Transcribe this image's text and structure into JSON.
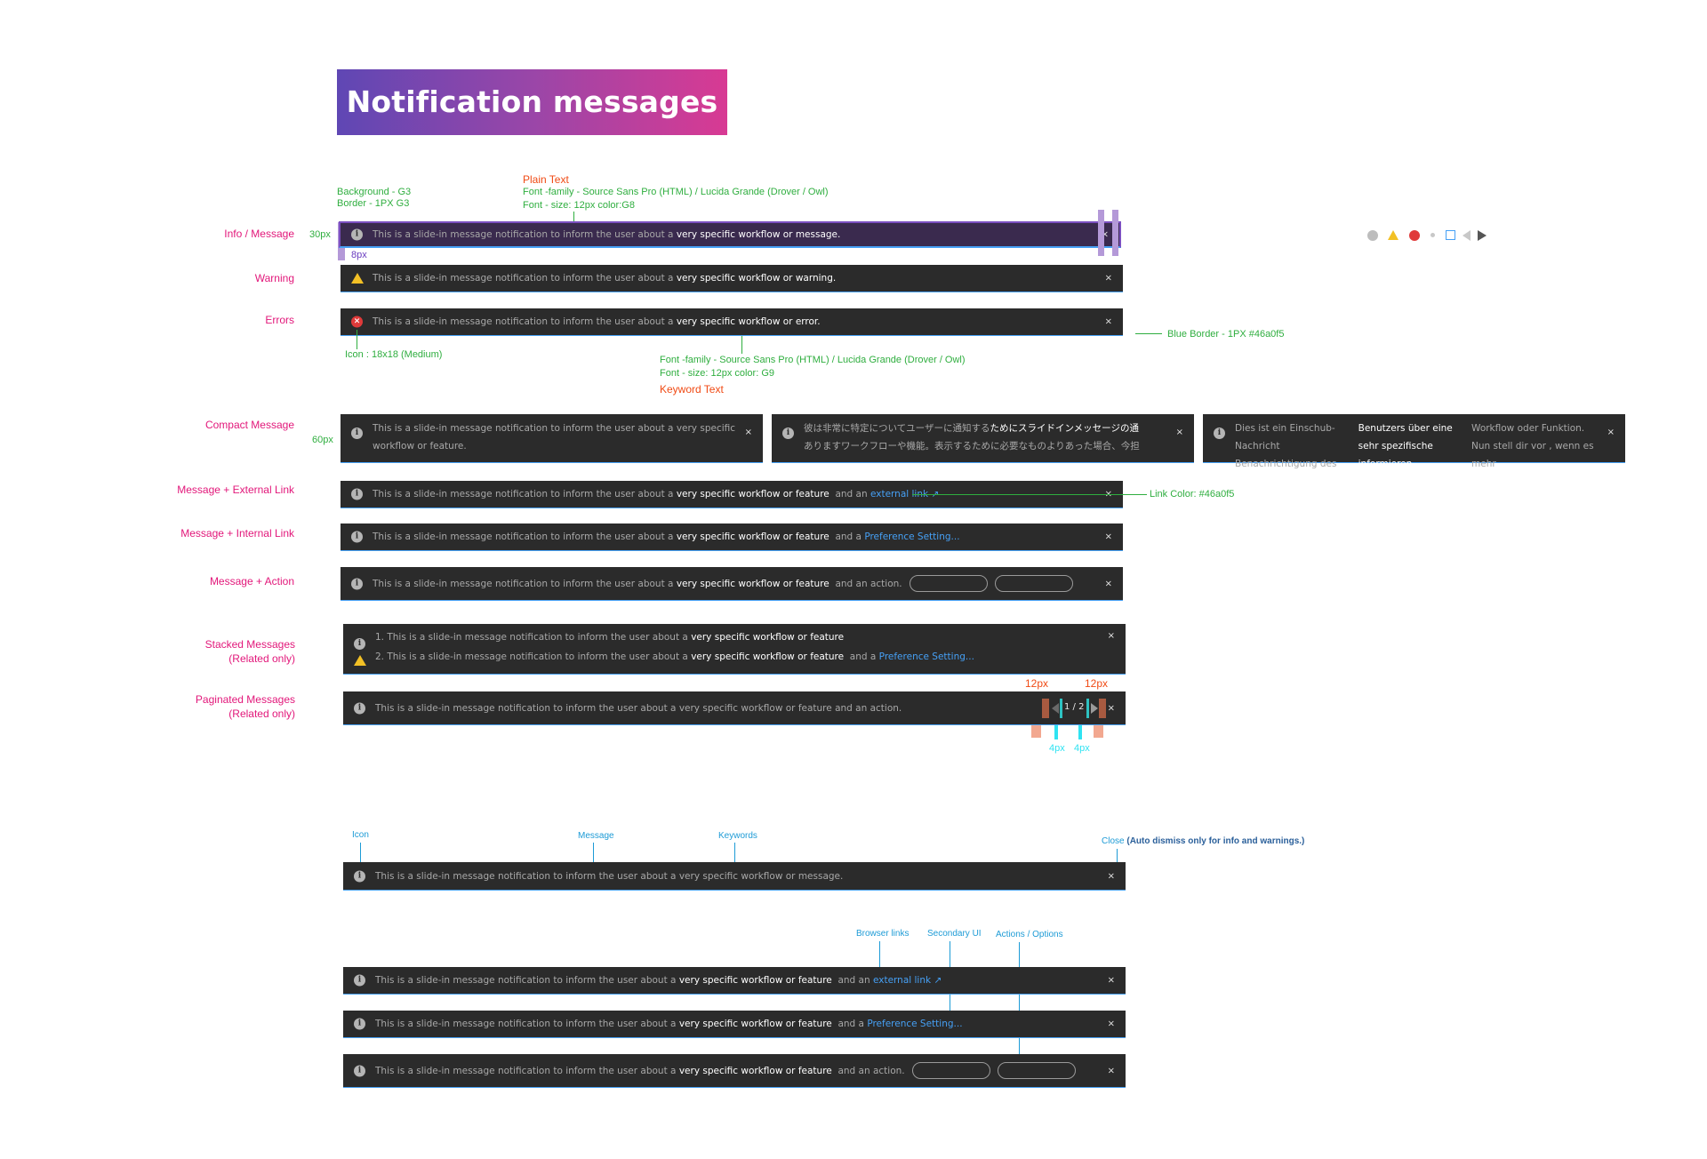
{
  "title": "Notification messages",
  "row_labels": {
    "info": "Info / Message",
    "warning": "Warning",
    "errors": "Errors",
    "compact": "Compact Message",
    "external": "Message + External Link",
    "internal": "Message + Internal Link",
    "action": "Message + Action",
    "stacked_1": "Stacked Messages",
    "stacked_2": "(Related only)",
    "paginated_1": "Paginated Messages",
    "paginated_2": "(Related only)"
  },
  "annotations": {
    "background_g3": "Background - G3",
    "border_g3": "Border - 1PX G3",
    "plain_text": "Plain Text",
    "font_family_1": "Font -family - Source Sans Pro (HTML) / Lucida Grande (Drover / Owl)",
    "font_size_1": "Font - size:  12px color:G8",
    "height_30": "30px",
    "pad_8": "8px",
    "blue_border": "Blue Border - 1PX #46a0f5",
    "icon_size": "Icon : 18x18 (Medium)",
    "font_family_2": "Font -family - Source Sans Pro (HTML) / Lucida Grande (Drover / Owl)",
    "font_size_2": "Font - size:  12px color: G9",
    "keyword_text": "Keyword Text",
    "height_60": "60px",
    "link_color": "Link Color: #46a0f5",
    "px12_a": "12px",
    "px12_b": "12px",
    "px4_a": "4px",
    "px4_b": "4px",
    "callout_icon": "Icon",
    "callout_message": "Message",
    "callout_keywords": "Keywords",
    "callout_close": "Close",
    "callout_close_note": "(Auto dismiss only for info and warnings.)",
    "callout_browser_links": "Browser links",
    "callout_secondary_ui": "Secondary UI",
    "callout_actions": "Actions / Options"
  },
  "messages": {
    "prefix": "This is a slide-in message notification to inform the user about a",
    "kw_message": "very specific workflow or message.",
    "kw_warning": "very specific workflow or warning.",
    "kw_error": "very specific workflow or error.",
    "kw_feature": "very specific workflow or feature",
    "compact_prefix": "This is a slide-in message notification to inform the user about a very specific workflow or feature.",
    "jp_plain": "彼は非常に特定についてユーザーに通知する",
    "jp_kw": "ためにスライドインメッセージの通",
    "jp_line2": "ありますワークフローや機能。表示するために必要なものよりあった場合、今担",
    "de_plain": "Dies ist ein Einschub-Nachricht Benachrichtigung des",
    "de_kw": "Benutzers über eine sehr spezifische informieren",
    "de_rest": "Workflow oder Funktion. Nun stell dir vor , wenn es mehr",
    "and_an": "and an",
    "and_a": "and a",
    "external_link": "external link",
    "pref_setting": "Preference Setting...",
    "and_an_action": "and an action.",
    "stacked_1_prefix": "1. This is a slide-in message notification to inform the user about a",
    "stacked_2_prefix": "2. This is a slide-in message notification to inform the user about a",
    "paginated_text": "This is a slide-in message notification to inform the user about a very specific workflow or feature  and an action.",
    "page_counter": "1 / 2",
    "close": "×"
  },
  "colors": {
    "background_g3": "#2b2b2b",
    "border_blue": "#46a0f5",
    "link": "#46a0f5",
    "label_pink": "#e2177a",
    "anno_green": "#2fae3f",
    "anno_orange": "#f04a14"
  }
}
